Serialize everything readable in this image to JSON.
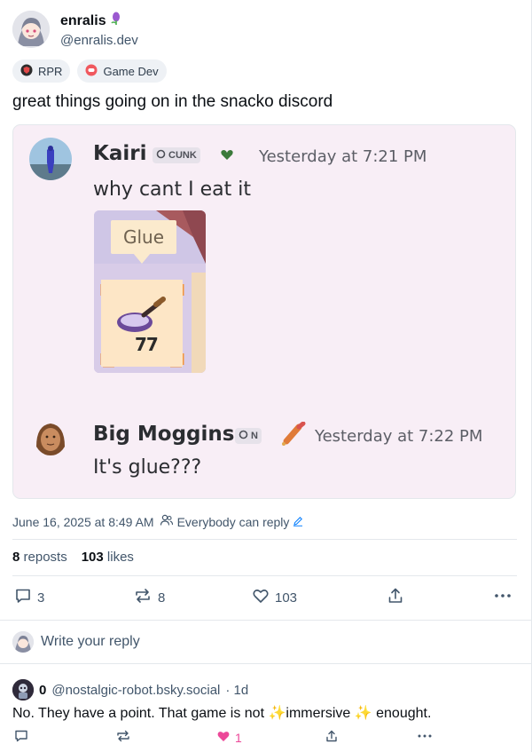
{
  "post": {
    "display_name": "enralis",
    "handle": "@enralis.dev",
    "labels": [
      {
        "label": "RPR",
        "icon": "shield-badge-icon"
      },
      {
        "label": "Game Dev",
        "icon": "controller-badge-icon"
      }
    ],
    "text": "great things going on in the snacko discord"
  },
  "embed": {
    "messages": [
      {
        "author": "Kairi",
        "tag": "CUNK",
        "time": "Yesterday at 7:21 PM",
        "text": "why cant I eat it"
      },
      {
        "author": "Big Moggins",
        "tag": "N",
        "time": "Yesterday at 7:22 PM",
        "text": "It's glue???"
      }
    ],
    "sticker": {
      "label": "Glue",
      "count": "77"
    }
  },
  "meta": {
    "timestamp": "June 16, 2025 at 8:49 AM",
    "reply_setting": "Everybody can reply"
  },
  "stats": {
    "reposts_count": "8",
    "reposts_label": "reposts",
    "likes_count": "103",
    "likes_label": "likes"
  },
  "actions": {
    "reply_count": "3",
    "repost_count": "8",
    "like_count": "103"
  },
  "reply_box": {
    "placeholder": "Write your reply"
  },
  "comment": {
    "display_name": "0",
    "handle": "@nostalgic-robot.bsky.social",
    "age": "· 1d",
    "text_before": "No. They have a point. That game is not",
    "text_emphasis": "immersive",
    "text_after": "enought.",
    "like_count": "1"
  },
  "colors": {
    "like_active": "#ec4899",
    "link_blue": "#1083fe",
    "muted": "#42566b",
    "embed_bg": "#f8eef6"
  }
}
